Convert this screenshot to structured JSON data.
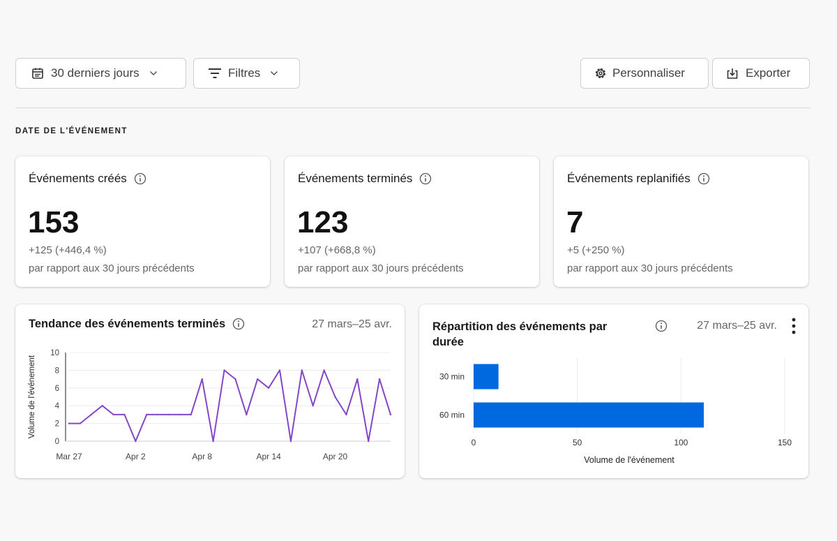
{
  "toolbar": {
    "date_range": {
      "label": "30 derniers jours",
      "icon": "calendar-icon"
    },
    "filters": {
      "label": "Filtres",
      "icon": "filter-icon"
    },
    "customize": {
      "label": "Personnaliser",
      "icon": "gear-icon"
    },
    "export": {
      "label": "Exporter",
      "icon": "export-icon"
    }
  },
  "section": {
    "title": "DATE DE L'ÉVÉNEMENT"
  },
  "kpis": [
    {
      "title": "Événements créés",
      "value": "153",
      "delta": "+125 (+446,4 %)",
      "sub": "par rapport aux 30 jours précédents"
    },
    {
      "title": "Événements terminés",
      "value": "123",
      "delta": "+107 (+668,8 %)",
      "sub": "par rapport aux 30 jours précédents"
    },
    {
      "title": "Événements replanifiés",
      "value": "7",
      "delta": "+5 (+250 %)",
      "sub": "par rapport aux 30 jours précédents"
    }
  ],
  "trend_card": {
    "title": "Tendance des événements terminés",
    "range": "27 mars–25 avr."
  },
  "dist_card": {
    "title": "Répartition des événements par durée",
    "range": "27 mars–25 avr."
  },
  "colors": {
    "line": "#8247c9",
    "bar": "#0069e0"
  },
  "chart_data": [
    {
      "type": "line",
      "ylabel": "Volume de l'événement",
      "ylim": [
        0,
        10
      ],
      "yticks": [
        0,
        2,
        4,
        6,
        8,
        10
      ],
      "xticks": [
        {
          "label": "Mar 27",
          "x": 0
        },
        {
          "label": "Apr 2",
          "x": 6
        },
        {
          "label": "Apr 8",
          "x": 12
        },
        {
          "label": "Apr 14",
          "x": 18
        },
        {
          "label": "Apr 20",
          "x": 24
        }
      ],
      "x_range": [
        0,
        29
      ],
      "grid": true,
      "series": [
        {
          "values": [
            2,
            2,
            3,
            4,
            3,
            3,
            0,
            3,
            3,
            3,
            3,
            3,
            7,
            0,
            8,
            7,
            3,
            7,
            6,
            8,
            0,
            8,
            4,
            8,
            5,
            3,
            7,
            0,
            7,
            3
          ]
        }
      ]
    },
    {
      "type": "bar",
      "orientation": "horizontal",
      "categories": [
        "30 min",
        "60 min"
      ],
      "values": [
        12,
        111
      ],
      "xlabel": "Volume de l'événement",
      "xlim": [
        0,
        150
      ],
      "xticks": [
        0,
        50,
        100,
        150
      ],
      "grid": true
    }
  ]
}
